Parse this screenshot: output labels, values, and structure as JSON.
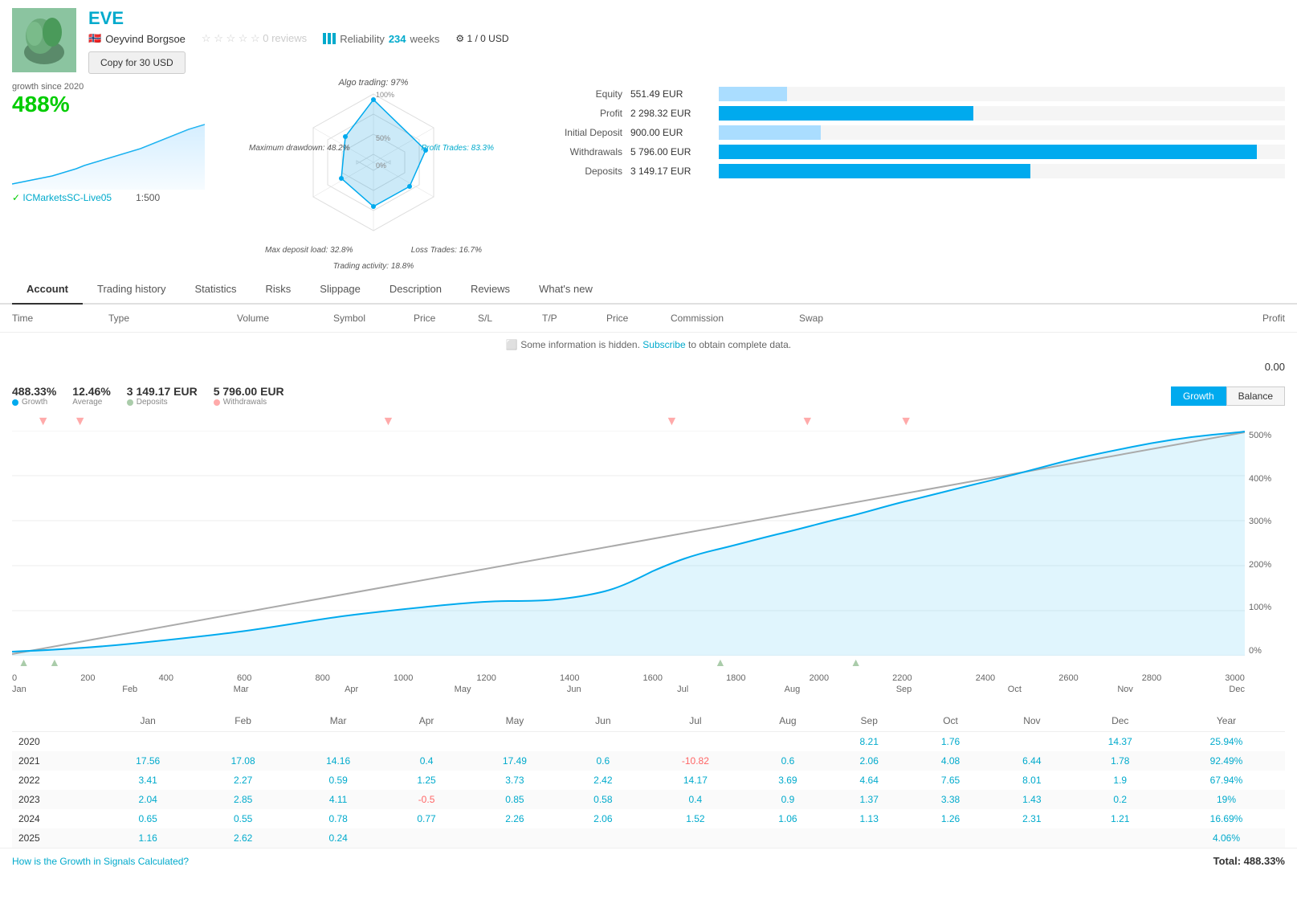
{
  "header": {
    "title": "EVE",
    "author": "Oeyvind Borgsoe",
    "reviews": "0 reviews",
    "reliability_label": "Reliability",
    "weeks": "234",
    "weeks_label": "weeks",
    "copies": "1 / 0 USD",
    "copy_btn": "Copy for 30 USD"
  },
  "stats": {
    "growth_since": "growth since 2020",
    "growth_pct": "488%",
    "leverage": "1:500",
    "broker": "ICMarketsSC-Live05"
  },
  "radar": {
    "algo_trading": "Algo trading: 97%",
    "profit_trades": "Profit Trades: 83.3%",
    "loss_trades": "Loss Trades: 16.7%",
    "trading_activity": "Trading activity: 18.8%",
    "max_deposit_load": "Max deposit load: 32.8%",
    "max_drawdown": "Maximum drawdown: 48.2%"
  },
  "metrics": [
    {
      "label": "Equity",
      "value": "551.49 EUR",
      "bar_pct": 12,
      "bar_type": "light"
    },
    {
      "label": "Profit",
      "value": "2 298.32 EUR",
      "bar_pct": 45,
      "bar_type": "normal"
    },
    {
      "label": "Initial Deposit",
      "value": "900.00 EUR",
      "bar_pct": 18,
      "bar_type": "light"
    },
    {
      "label": "Withdrawals",
      "value": "5 796.00 EUR",
      "bar_pct": 95,
      "bar_type": "normal"
    },
    {
      "label": "Deposits",
      "value": "3 149.17 EUR",
      "bar_pct": 55,
      "bar_type": "normal"
    }
  ],
  "tabs": [
    "Account",
    "Trading history",
    "Statistics",
    "Risks",
    "Slippage",
    "Description",
    "Reviews",
    "What's new"
  ],
  "active_tab": "Account",
  "table_headers": [
    "Time",
    "Type",
    "Volume",
    "Symbol",
    "Price",
    "S/L",
    "T/P",
    "Price",
    "Commission",
    "Swap",
    "Profit"
  ],
  "hidden_info": "Some information is hidden.",
  "subscribe_text": "Subscribe",
  "subscribe_suffix": "to obtain complete data.",
  "profit_total": "0.00",
  "growth_stats": {
    "pct": "488.33%",
    "avg": "12.46%",
    "deposits": "3 149.17 EUR",
    "withdrawals": "5 796.00 EUR",
    "labels": {
      "pct": "Growth",
      "avg": "Average",
      "deposits": "Deposits",
      "withdrawals": "Withdrawals"
    }
  },
  "toggle": {
    "growth": "Growth",
    "balance": "Balance"
  },
  "chart": {
    "y_labels": [
      "500%",
      "400%",
      "300%",
      "200%",
      "100%",
      "0%"
    ],
    "x_numbers": [
      "0",
      "200",
      "400",
      "600",
      "800",
      "1000",
      "1200",
      "1400",
      "1600",
      "1800",
      "2000",
      "2200",
      "2400",
      "2600",
      "2800",
      "3000"
    ],
    "x_months": [
      "Jan",
      "Feb",
      "Mar",
      "Apr",
      "May",
      "Jun",
      "Jul",
      "Aug",
      "Sep",
      "Oct",
      "Nov",
      "Dec"
    ]
  },
  "monthly_headers": [
    "",
    "Jan",
    "Feb",
    "Mar",
    "Apr",
    "May",
    "Jun",
    "Jul",
    "Aug",
    "Sep",
    "Oct",
    "Nov",
    "Dec",
    "Year"
  ],
  "monthly_data": [
    {
      "year": "2020",
      "values": [
        "",
        "",
        "",
        "",
        "",
        "",
        "",
        "",
        "8.21",
        "1.76",
        "",
        "14.37",
        "25.94%"
      ]
    },
    {
      "year": "2021",
      "values": [
        "17.56",
        "17.08",
        "14.16",
        "0.4",
        "17.49",
        "0.6",
        "-10.82",
        "0.6",
        "2.06",
        "4.08",
        "6.44",
        "1.78",
        "92.49%"
      ]
    },
    {
      "year": "2022",
      "values": [
        "3.41",
        "2.27",
        "0.59",
        "1.25",
        "3.73",
        "2.42",
        "14.17",
        "3.69",
        "4.64",
        "7.65",
        "8.01",
        "1.9",
        "67.94%"
      ]
    },
    {
      "year": "2023",
      "values": [
        "2.04",
        "2.85",
        "4.11",
        "-0.5",
        "0.85",
        "0.58",
        "0.4",
        "0.9",
        "1.37",
        "3.38",
        "1.43",
        "0.2",
        "19%"
      ]
    },
    {
      "year": "2024",
      "values": [
        "0.65",
        "0.55",
        "0.78",
        "0.77",
        "2.26",
        "2.06",
        "1.52",
        "1.06",
        "1.13",
        "1.26",
        "2.31",
        "1.21",
        "16.69%"
      ]
    },
    {
      "year": "2025",
      "values": [
        "1.16",
        "2.62",
        "0.24",
        "",
        "",
        "",
        "",
        "",
        "",
        "",
        "",
        "",
        "4.06%"
      ]
    }
  ],
  "footer": {
    "link": "How is the Growth in Signals Calculated?",
    "total": "Total: 488.33%"
  }
}
